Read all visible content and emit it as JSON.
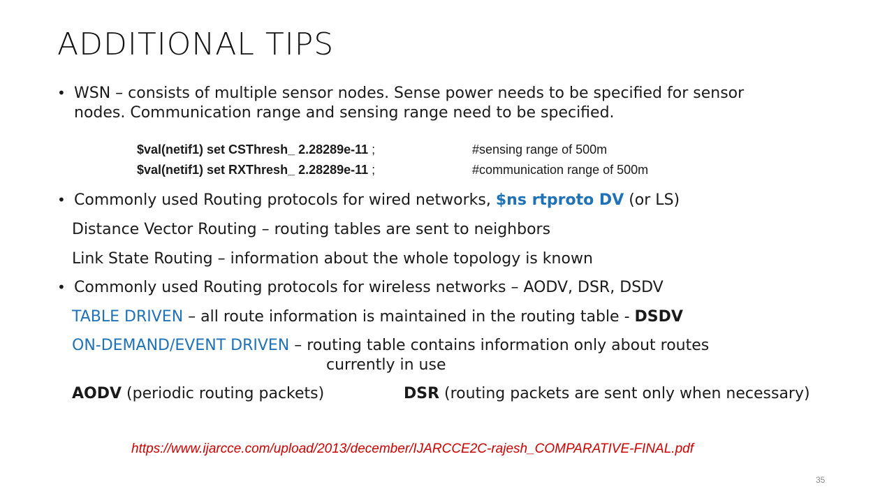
{
  "slide": {
    "title": "ADDITIONAL TIPS",
    "bullet1": {
      "line1": "WSN – consists of multiple sensor nodes. Sense power needs to be specified for sensor",
      "line2": "nodes. Communication range and sensing range need to be specified."
    },
    "code": {
      "line1_cmd": "$val(netif1) set CSThresh_ 2.28289e-11",
      "line1_sep": " ;",
      "line1_comment": "#sensing range of 500m",
      "line2_cmd": "$val(netif1) set RXThresh_ 2.28289e-11",
      "line2_sep": " ;",
      "line2_comment": "#communication range of 500m"
    },
    "bullet2": {
      "text": "Commonly used Routing protocols for wired networks, ",
      "cmd": "$ns rtproto DV",
      "suffix": " (or LS)"
    },
    "dv_line": "Distance Vector Routing – routing tables are sent to neighbors",
    "ls_line": "Link State Routing – information about the whole topology is known",
    "bullet3": "Commonly used Routing protocols for wireless networks – AODV, DSR, DSDV",
    "table_driven": {
      "label": "TABLE DRIVEN",
      "text": " – all route information is maintained in the routing table - ",
      "proto": "DSDV"
    },
    "on_demand": {
      "label": "ON-DEMAND/EVENT DRIVEN",
      "text": " – routing table contains information only about routes",
      "cont": "currently in use"
    },
    "aodv": {
      "label": "AODV",
      "text": " (periodic routing packets)"
    },
    "dsr": {
      "label": "DSR",
      "text": " (routing packets are sent only when necessary)"
    },
    "reference_url": "https://www.ijarcce.com/upload/2013/december/IJARCCE2C-rajesh_COMPARATIVE-FINAL.pdf",
    "page_number": "35"
  },
  "colors": {
    "accent_blue": "#1f72b6",
    "link_red": "#cc0000"
  }
}
